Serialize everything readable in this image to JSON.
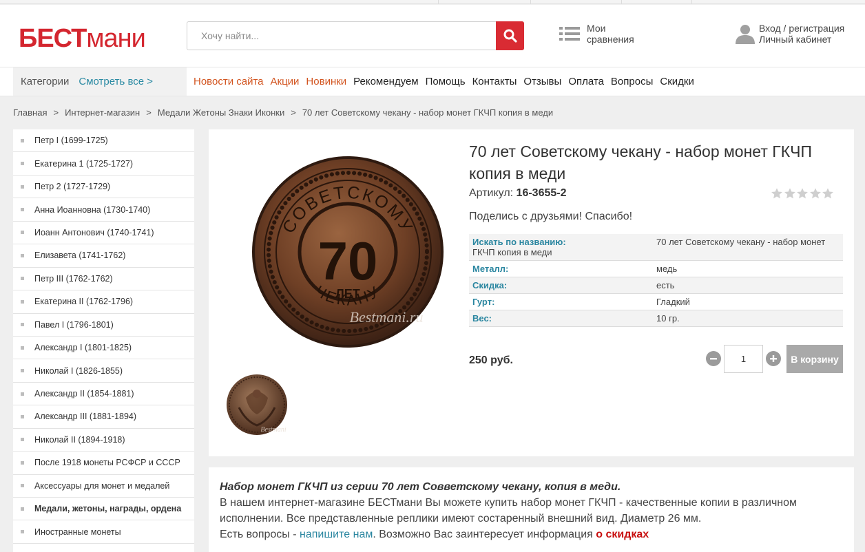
{
  "header": {
    "logo_part1": "БЕСТ",
    "logo_part2": "мани",
    "search_placeholder": "Хочу найти...",
    "compare_line1": "Мои",
    "compare_line2": "сравнения",
    "account_line1": "Вход / регистрация",
    "account_line2": "Личный кабинет"
  },
  "nav": {
    "categories_label": "Категории",
    "see_all_label": "Смотреть все >",
    "menu": [
      {
        "label": "Новости сайта",
        "highlight": true
      },
      {
        "label": "Акции",
        "highlight": true
      },
      {
        "label": "Новинки",
        "highlight": true
      },
      {
        "label": "Рекомендуем",
        "highlight": false
      },
      {
        "label": "Помощь",
        "highlight": false
      },
      {
        "label": "Контакты",
        "highlight": false
      },
      {
        "label": "Отзывы",
        "highlight": false
      },
      {
        "label": "Оплата",
        "highlight": false
      },
      {
        "label": "Вопросы",
        "highlight": false
      },
      {
        "label": "Скидки",
        "highlight": false
      }
    ]
  },
  "breadcrumb": [
    "Главная",
    "Интернет-магазин",
    "Медали Жетоны Знаки Иконки",
    "70 лет Советскому чекану - набор монет ГКЧП копия в меди"
  ],
  "sidebar": {
    "items": [
      "Петр I (1699-1725)",
      "Екатерина 1 (1725-1727)",
      "Петр 2 (1727-1729)",
      "Анна Иоанновна (1730-1740)",
      "Иоанн Антонович (1740-1741)",
      "Елизавета (1741-1762)",
      "Петр III (1762-1762)",
      "Екатерина II (1762-1796)",
      "Павел I (1796-1801)",
      "Александр I (1801-1825)",
      "Николай I (1826-1855)",
      "Александр II (1854-1881)",
      "Александр III (1881-1894)",
      "Николай II (1894-1918)",
      "После 1918 монеты РСФСР и СССР",
      "Аксессуары для монет и медалей",
      "Медали, жетоны, награды, ордена",
      "Иностранные монеты"
    ],
    "bold_index": 16
  },
  "product": {
    "title": "70 лет Советскому чекану - набор монет ГКЧП копия в меди",
    "sku_label": "Артикул:",
    "sku_value": "16-3655-2",
    "rating": 0,
    "share_text": "Поделись с друзьями! Спасибо!",
    "coin_top_text": "СОВЕТСКОМУ",
    "coin_number": "70",
    "coin_small_text": "ЛЕТ",
    "coin_bottom_text": "ЧЕКАНУ",
    "watermark": "Bestmani.ru",
    "thumb_watermark": "Bestmani",
    "props": [
      {
        "key": "Искать по названию:",
        "value": "70 лет Советскому чекану - набор монет",
        "cont": "ГКЧП копия в меди"
      },
      {
        "key": "Металл:",
        "value": "медь"
      },
      {
        "key": "Скидка:",
        "value": "есть"
      },
      {
        "key": "Гурт:",
        "value": "Гладкий"
      },
      {
        "key": "Вес:",
        "value": "10 гр."
      }
    ],
    "price": "250 руб.",
    "quantity": "1",
    "cart_label": "В корзину"
  },
  "description": {
    "heading": "Набор монет ГКЧП из серии 70 лет Совветскому чекану, копия в меди.",
    "line1": "В нашем интернет-магазине БЕСТмани Вы можете купить набор монет ГКЧП - качественные копии в различном исполнении. Все представленные реплики имеют состаренный внешний вид. Диаметр 26 мм.",
    "q_prefix": "Есть вопросы - ",
    "q_link": "напишите нам",
    "q_middle": ". Возможно Вас заинтересует информация ",
    "q_link2": "о скидках"
  },
  "colors": {
    "brand_red": "#d4262f",
    "link_teal": "#2a86a0",
    "nav_highlight": "#d2541f",
    "coin_copper": "#7a4a2e"
  }
}
